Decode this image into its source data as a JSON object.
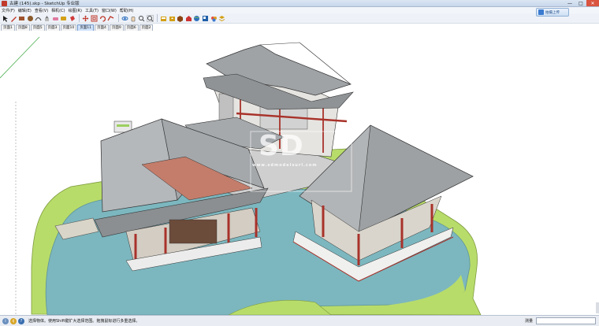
{
  "window": {
    "title": "古建 (145).skp - SketchUp 专业版",
    "controls": [
      "—",
      "□",
      "✕"
    ]
  },
  "menu": [
    "文件(F)",
    "编辑(E)",
    "查看(V)",
    "相机(C)",
    "绘图(R)",
    "工具(T)",
    "窗口(W)",
    "帮助(H)"
  ],
  "toolbar": {
    "tools": [
      {
        "icon": "select-arrow-icon",
        "color": "#222222"
      },
      {
        "icon": "pencil-icon",
        "color": "#c0392b"
      },
      {
        "icon": "rectangle-icon",
        "color": "#a0522d"
      },
      {
        "icon": "circle-icon",
        "color": "#8b5a2b"
      },
      {
        "icon": "arc-icon",
        "color": "#555555"
      },
      {
        "icon": "push-pull-icon",
        "color": "#777777"
      },
      {
        "icon": "eraser-icon",
        "color": "#e07aa0"
      },
      {
        "icon": "tape-measure-icon",
        "color": "#d4a017"
      },
      {
        "icon": "paint-bucket-icon",
        "color": "#cf3a3a"
      },
      {
        "icon": "move-icon",
        "color": "#c0392b"
      },
      {
        "icon": "offset-icon",
        "color": "#c0392b"
      },
      {
        "icon": "rotate-icon",
        "color": "#c0392b"
      },
      {
        "icon": "follow-me-icon",
        "color": "#c0392b"
      },
      {
        "icon": "orbit-icon",
        "color": "#2e6fbf"
      },
      {
        "icon": "pan-icon",
        "color": "#444444"
      },
      {
        "icon": "zoom-icon",
        "color": "#444444"
      },
      {
        "icon": "zoom-extents-icon",
        "color": "#444444"
      },
      {
        "icon": "get-models-icon",
        "color": "#d4a017"
      },
      {
        "icon": "share-model-icon",
        "color": "#d4a017"
      },
      {
        "icon": "components-icon",
        "color": "#8b4513"
      },
      {
        "icon": "warehouse-icon",
        "color": "#cc3333"
      },
      {
        "icon": "google-earth-icon",
        "color": "#2e6fbf"
      },
      {
        "icon": "styles-icon",
        "color": "#1f5fa8"
      },
      {
        "icon": "materials-icon",
        "color": "#e0a020"
      },
      {
        "icon": "layers-icon",
        "color": "#d4a017"
      }
    ],
    "upload_label": "拍摄上传"
  },
  "scenes": {
    "tabs": [
      "页面1",
      "页面8",
      "页面5",
      "页面3",
      "页面10",
      "页面11",
      "页面4",
      "页面9",
      "页面6",
      "页面2"
    ],
    "active_index": 5
  },
  "viewport": {
    "watermark_main": "SD",
    "watermark_sub": "www.sdmodelsurl.com",
    "water_color": "#7cb7bf",
    "lawn_color": "#b8dc6a",
    "roof_color": "#9fa3a6",
    "column_color": "#a8322a"
  },
  "status": {
    "message": "选择物体。使用Shift键扩大选择范围。拖拽鼠标进行多重选择。",
    "measure_label": "测量"
  }
}
